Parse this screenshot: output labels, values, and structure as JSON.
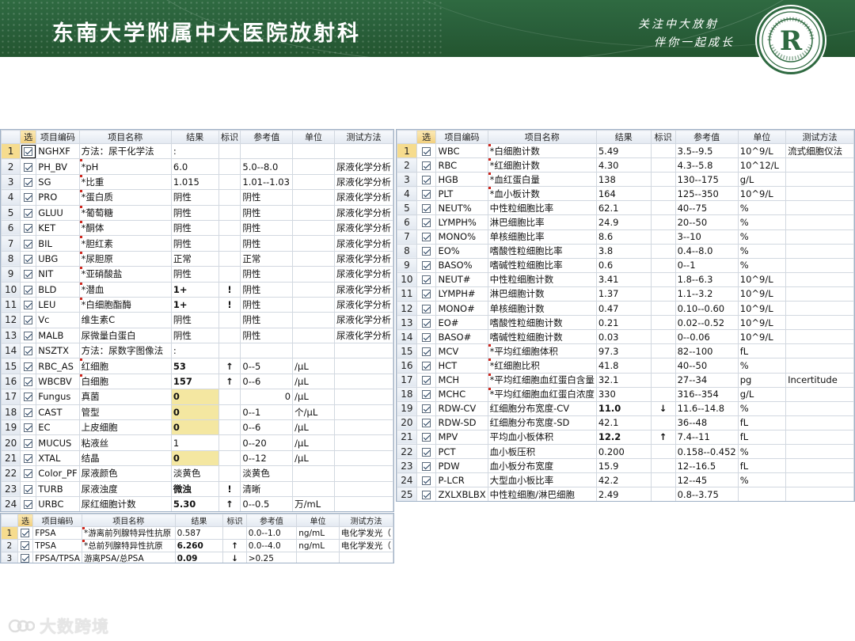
{
  "header": {
    "title": "东南大学附属中大医院放射科",
    "slogan_line1": "关注中大放射",
    "slogan_line2": "伴你一起成长",
    "logo_letter": "R"
  },
  "columns_left": [
    "选",
    "项目编码",
    "项目名称",
    "结果",
    "标识",
    "参考值",
    "单位",
    "测试方法"
  ],
  "columns_right": [
    "选",
    "项目编码",
    "项目名称",
    "结果",
    "标识",
    "参考值",
    "单位",
    "测试方法"
  ],
  "urine_rows": [
    {
      "n": "1",
      "code": "NGHXF",
      "name": "方法：尿干化学法",
      "result": ":",
      "flag": "",
      "ref": "",
      "unit": "",
      "method": "",
      "mark": false
    },
    {
      "n": "2",
      "code": "PH_BV",
      "name": "*pH",
      "result": "6.0",
      "flag": "",
      "ref": "5.0--8.0",
      "unit": "",
      "method": "尿液化学分析",
      "mark": true
    },
    {
      "n": "3",
      "code": "SG",
      "name": "*比重",
      "result": "1.015",
      "flag": "",
      "ref": "1.01--1.03",
      "unit": "",
      "method": "尿液化学分析",
      "mark": true
    },
    {
      "n": "4",
      "code": "PRO",
      "name": "*蛋白质",
      "result": "阴性",
      "flag": "",
      "ref": "阴性",
      "unit": "",
      "method": "尿液化学分析",
      "mark": true
    },
    {
      "n": "5",
      "code": "GLUU",
      "name": "*葡萄糖",
      "result": "阴性",
      "flag": "",
      "ref": "阴性",
      "unit": "",
      "method": "尿液化学分析",
      "mark": true
    },
    {
      "n": "6",
      "code": "KET",
      "name": "*酮体",
      "result": "阴性",
      "flag": "",
      "ref": "阴性",
      "unit": "",
      "method": "尿液化学分析",
      "mark": true
    },
    {
      "n": "7",
      "code": "BIL",
      "name": "*胆红素",
      "result": "阴性",
      "flag": "",
      "ref": "阴性",
      "unit": "",
      "method": "尿液化学分析",
      "mark": true
    },
    {
      "n": "8",
      "code": "UBG",
      "name": "*尿胆原",
      "result": "正常",
      "flag": "",
      "ref": "正常",
      "unit": "",
      "method": "尿液化学分析",
      "mark": true
    },
    {
      "n": "9",
      "code": "NIT",
      "name": "*亚硝酸盐",
      "result": "阴性",
      "flag": "",
      "ref": "阴性",
      "unit": "",
      "method": "尿液化学分析",
      "mark": true
    },
    {
      "n": "10",
      "code": "BLD",
      "name": "*潜血",
      "result": "1+",
      "flag": "!",
      "ref": "阴性",
      "unit": "",
      "method": "尿液化学分析",
      "mark": true,
      "style": "hi"
    },
    {
      "n": "11",
      "code": "LEU",
      "name": "*白细胞酯酶",
      "result": "1+",
      "flag": "!",
      "ref": "阴性",
      "unit": "",
      "method": "尿液化学分析",
      "mark": true,
      "style": "hi"
    },
    {
      "n": "12",
      "code": "Vc",
      "name": "维生素C",
      "result": "阴性",
      "flag": "",
      "ref": "阴性",
      "unit": "",
      "method": "尿液化学分析",
      "mark": false
    },
    {
      "n": "13",
      "code": "MALB",
      "name": "尿微量白蛋白",
      "result": "阴性",
      "flag": "",
      "ref": "阴性",
      "unit": "",
      "method": "尿液化学分析",
      "mark": false
    },
    {
      "n": "14",
      "code": "NSZTX",
      "name": "方法：尿数字图像法",
      "result": ":",
      "flag": "",
      "ref": "",
      "unit": "",
      "method": "",
      "mark": false
    },
    {
      "n": "15",
      "code": "RBC_AS",
      "name": "红细胞",
      "result": "53",
      "flag": "↑",
      "ref": "0--5",
      "unit": "/μL",
      "method": "",
      "mark": true,
      "style": "hi"
    },
    {
      "n": "16",
      "code": "WBCBV",
      "name": "白细胞",
      "result": "157",
      "flag": "↑",
      "ref": "0--6",
      "unit": "/μL",
      "method": "",
      "mark": true,
      "style": "hi"
    },
    {
      "n": "17",
      "code": "Fungus",
      "name": "真菌",
      "result": "0",
      "flag": "",
      "ref": "0",
      "unit": "/μL",
      "method": "",
      "mark": false,
      "style": "yellow",
      "refRight": true
    },
    {
      "n": "18",
      "code": "CAST",
      "name": "管型",
      "result": "0",
      "flag": "",
      "ref": "0--1",
      "unit": "个/μL",
      "method": "",
      "mark": false,
      "style": "yellow"
    },
    {
      "n": "19",
      "code": "EC",
      "name": "上皮细胞",
      "result": "0",
      "flag": "",
      "ref": "0--6",
      "unit": "/μL",
      "method": "",
      "mark": false,
      "style": "yellow"
    },
    {
      "n": "20",
      "code": "MUCUS",
      "name": "粘液丝",
      "result": "1",
      "flag": "",
      "ref": "0--20",
      "unit": "/μL",
      "method": "",
      "mark": false
    },
    {
      "n": "21",
      "code": "XTAL",
      "name": "结晶",
      "result": "0",
      "flag": "",
      "ref": "0--12",
      "unit": "/μL",
      "method": "",
      "mark": false,
      "style": "yellow"
    },
    {
      "n": "22",
      "code": "Color_PF",
      "name": "尿液颜色",
      "result": "淡黄色",
      "flag": "",
      "ref": "淡黄色",
      "unit": "",
      "method": "",
      "mark": false
    },
    {
      "n": "23",
      "code": "TURB",
      "name": "尿液浊度",
      "result": "微浊",
      "flag": "!",
      "ref": "清晰",
      "unit": "",
      "method": "",
      "mark": false,
      "style": "hi"
    },
    {
      "n": "24",
      "code": "URBC",
      "name": "尿红细胞计数",
      "result": "5.30",
      "flag": "↑",
      "ref": "0--0.5",
      "unit": "万/mL",
      "method": "",
      "mark": false,
      "style": "hi"
    }
  ],
  "psa_rows": [
    {
      "n": "1",
      "code": "FPSA",
      "name": "*游离前列腺特异性抗原",
      "result": "0.587",
      "flag": "",
      "ref": "0.0--1.0",
      "unit": "ng/mL",
      "method": "电化学发光（",
      "mark": true
    },
    {
      "n": "2",
      "code": "TPSA",
      "name": "*总前列腺特异性抗原",
      "result": "6.260",
      "flag": "↑",
      "ref": "0.0--4.0",
      "unit": "ng/mL",
      "method": "电化学发光（",
      "mark": true,
      "style": "hi"
    },
    {
      "n": "3",
      "code": "FPSA/TPSA",
      "name": "游离PSA/总PSA",
      "result": "0.09",
      "flag": "↓",
      "ref": ">0.25",
      "unit": "",
      "method": "",
      "mark": false,
      "style": "lo"
    }
  ],
  "blood_rows": [
    {
      "n": "1",
      "code": "WBC",
      "name": "*白细胞计数",
      "result": "5.49",
      "flag": "",
      "ref": "3.5--9.5",
      "unit": "10^9/L",
      "method": "流式细胞仪法",
      "mark": true
    },
    {
      "n": "2",
      "code": "RBC",
      "name": "*红细胞计数",
      "result": "4.30",
      "flag": "",
      "ref": "4.3--5.8",
      "unit": "10^12/L",
      "method": "",
      "mark": true
    },
    {
      "n": "3",
      "code": "HGB",
      "name": "*血红蛋白量",
      "result": "138",
      "flag": "",
      "ref": "130--175",
      "unit": "g/L",
      "method": "",
      "mark": true
    },
    {
      "n": "4",
      "code": "PLT",
      "name": "*血小板计数",
      "result": "164",
      "flag": "",
      "ref": "125--350",
      "unit": "10^9/L",
      "method": "",
      "mark": true
    },
    {
      "n": "5",
      "code": "NEUT%",
      "name": "中性粒细胞比率",
      "result": "62.1",
      "flag": "",
      "ref": "40--75",
      "unit": "%",
      "method": "",
      "mark": false
    },
    {
      "n": "6",
      "code": "LYMPH%",
      "name": "淋巴细胞比率",
      "result": "24.9",
      "flag": "",
      "ref": "20--50",
      "unit": "%",
      "method": "",
      "mark": false
    },
    {
      "n": "7",
      "code": "MONO%",
      "name": "单核细胞比率",
      "result": "8.6",
      "flag": "",
      "ref": "3--10",
      "unit": "%",
      "method": "",
      "mark": false
    },
    {
      "n": "8",
      "code": "EO%",
      "name": "嗜酸性粒细胞比率",
      "result": "3.8",
      "flag": "",
      "ref": "0.4--8.0",
      "unit": "%",
      "method": "",
      "mark": false
    },
    {
      "n": "9",
      "code": "BASO%",
      "name": "嗜碱性粒细胞比率",
      "result": "0.6",
      "flag": "",
      "ref": "0--1",
      "unit": "%",
      "method": "",
      "mark": false
    },
    {
      "n": "10",
      "code": "NEUT#",
      "name": "中性粒细胞计数",
      "result": "3.41",
      "flag": "",
      "ref": "1.8--6.3",
      "unit": "10^9/L",
      "method": "",
      "mark": false
    },
    {
      "n": "11",
      "code": "LYMPH#",
      "name": "淋巴细胞计数",
      "result": "1.37",
      "flag": "",
      "ref": "1.1--3.2",
      "unit": "10^9/L",
      "method": "",
      "mark": false
    },
    {
      "n": "12",
      "code": "MONO#",
      "name": "单核细胞计数",
      "result": "0.47",
      "flag": "",
      "ref": "0.10--0.60",
      "unit": "10^9/L",
      "method": "",
      "mark": false
    },
    {
      "n": "13",
      "code": "EO#",
      "name": "嗜酸性粒细胞计数",
      "result": "0.21",
      "flag": "",
      "ref": "0.02--0.52",
      "unit": "10^9/L",
      "method": "",
      "mark": false
    },
    {
      "n": "14",
      "code": "BASO#",
      "name": "嗜碱性粒细胞计数",
      "result": "0.03",
      "flag": "",
      "ref": "0--0.06",
      "unit": "10^9/L",
      "method": "",
      "mark": false
    },
    {
      "n": "15",
      "code": "MCV",
      "name": "*平均红细胞体积",
      "result": "97.3",
      "flag": "",
      "ref": "82--100",
      "unit": "fL",
      "method": "",
      "mark": true
    },
    {
      "n": "16",
      "code": "HCT",
      "name": "*红细胞比积",
      "result": "41.8",
      "flag": "",
      "ref": "40--50",
      "unit": "%",
      "method": "",
      "mark": true
    },
    {
      "n": "17",
      "code": "MCH",
      "name": "*平均红细胞血红蛋白含量",
      "result": "32.1",
      "flag": "",
      "ref": "27--34",
      "unit": "pg",
      "method": "Incertitude",
      "mark": true
    },
    {
      "n": "18",
      "code": "MCHC",
      "name": "*平均红细胞血红蛋白浓度",
      "result": "330",
      "flag": "",
      "ref": "316--354",
      "unit": "g/L",
      "method": "",
      "mark": true
    },
    {
      "n": "19",
      "code": "RDW-CV",
      "name": "红细胞分布宽度-CV",
      "result": "11.0",
      "flag": "↓",
      "ref": "11.6--14.8",
      "unit": "%",
      "method": "",
      "mark": false,
      "style": "lo"
    },
    {
      "n": "20",
      "code": "RDW-SD",
      "name": "红细胞分布宽度-SD",
      "result": "42.1",
      "flag": "",
      "ref": "36--48",
      "unit": "fL",
      "method": "",
      "mark": false
    },
    {
      "n": "21",
      "code": "MPV",
      "name": "平均血小板体积",
      "result": "12.2",
      "flag": "↑",
      "ref": "7.4--11",
      "unit": "fL",
      "method": "",
      "mark": false,
      "style": "hi"
    },
    {
      "n": "22",
      "code": "PCT",
      "name": "血小板压积",
      "result": "0.200",
      "flag": "",
      "ref": "0.158--0.452",
      "unit": "%",
      "method": "",
      "mark": false
    },
    {
      "n": "23",
      "code": "PDW",
      "name": "血小板分布宽度",
      "result": "15.9",
      "flag": "",
      "ref": "12--16.5",
      "unit": "fL",
      "method": "",
      "mark": false
    },
    {
      "n": "24",
      "code": "P-LCR",
      "name": "大型血小板比率",
      "result": "42.2",
      "flag": "",
      "ref": "12--45",
      "unit": "%",
      "method": "",
      "mark": false
    },
    {
      "n": "25",
      "code": "ZXLXBLBX",
      "name": "中性粒细胞/淋巴细胞",
      "result": "2.49",
      "flag": "",
      "ref": "0.8--3.75",
      "unit": "",
      "method": "",
      "mark": false
    }
  ],
  "watermark": {
    "text": "大数跨境"
  },
  "colors": {
    "banner": "#2f6a41",
    "high": "#e0281d",
    "low": "#1b3cc9",
    "highlight": "#f4e7a1"
  }
}
